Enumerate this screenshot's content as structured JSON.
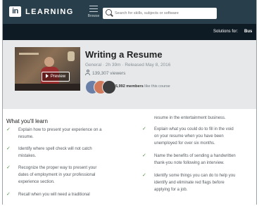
{
  "header": {
    "logo": "in",
    "brand": "LEARNING",
    "browse_label": "Browse",
    "search_placeholder": "Search for skills, subjects or software"
  },
  "subbar": {
    "solutions_label": "Solutions for:",
    "business_label": "Bus"
  },
  "course": {
    "preview_label": "Preview",
    "title": "Writing a Resume",
    "meta": "General · 2h 39m · Released May 8, 2016",
    "viewers": "139,307 viewers",
    "members_count": "5,992 members",
    "members_suffix": "like this course"
  },
  "learn": {
    "heading": "What you'll learn",
    "left_items": [
      [
        "Explain how to present your experience on a",
        "resume."
      ],
      [
        "Identify where spell check will not catch",
        "mistakes."
      ],
      [
        "Recognize the proper way to present your",
        "dates of employment in your professional",
        "experience section."
      ],
      [
        "Recall when you will need a traditional"
      ]
    ],
    "right_continuation": "resume in the entertainment business.",
    "right_items": [
      [
        "Explain what you could do to fill in the void",
        "on your resume when you have been",
        "unemployed for over six months."
      ],
      [
        "Name the benefits of sending a handwritten",
        "thank-you note following an interview."
      ],
      [
        "Identify some things you can do to help you",
        "identify and eliminate red flags before",
        "applying for a job."
      ]
    ]
  },
  "colors": {
    "topbar": "#283e4a",
    "subbar": "#0f1b24",
    "hero_bg": "#e6e8ea",
    "check": "#4a8f3a"
  }
}
